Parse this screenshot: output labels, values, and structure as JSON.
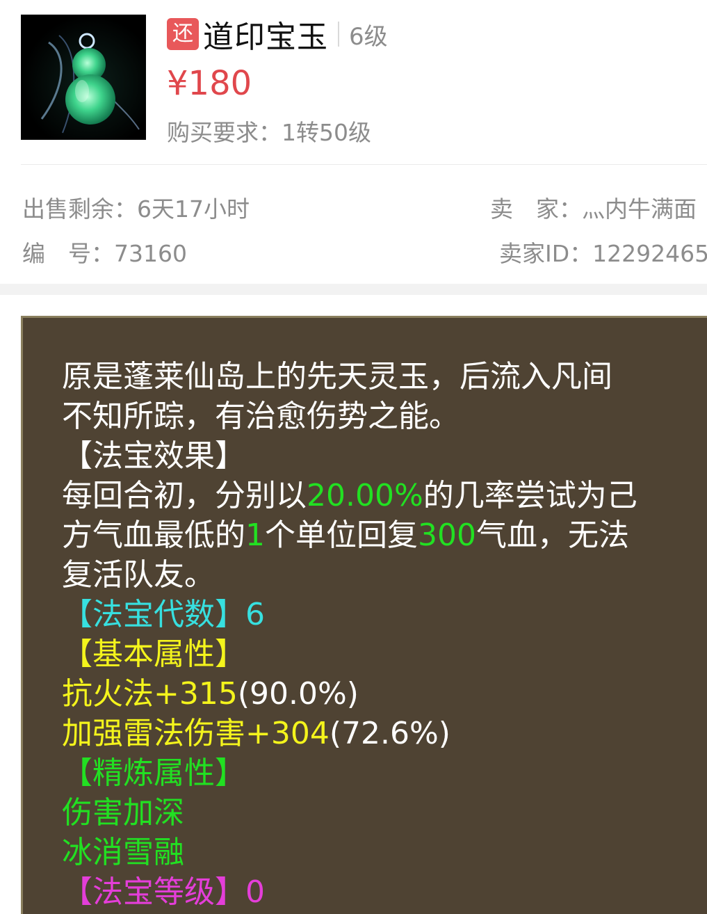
{
  "item": {
    "badge": "还",
    "name": "道印宝玉",
    "level": "6级",
    "price": "¥180",
    "requirement": "购买要求：1转50级"
  },
  "meta": {
    "remaining_label": "出售剩余：6天17小时",
    "seller_label": "卖　家：",
    "seller_name": "灬内牛满面",
    "id_label": "编　号：73160",
    "seller_id": "卖家ID：12292465"
  },
  "details": {
    "desc_line1": "原是蓬莱仙岛上的先天灵玉，后流入凡间",
    "desc_line2": "不知所踪，有治愈伤势之能。",
    "effect_header": "【法宝效果】",
    "effect_a1": "每回合初，分别以",
    "effect_a2": "20.00%",
    "effect_a3": "的几率尝试为己",
    "effect_b1": "方气血最低的",
    "effect_b2": "1",
    "effect_b3": "个单位回复",
    "effect_b4": "300",
    "effect_b5": "气血，无法",
    "effect_c": "复活队友。",
    "gen_label": "【法宝代数】6",
    "basic_header": "【基本属性】",
    "basic_1a": "抗火法+315",
    "basic_1b": "(90.0%)",
    "basic_2a": "加强雷法伤害+304",
    "basic_2b": "(72.6%)",
    "refine_header": "【精炼属性】",
    "refine_1": "伤害加深",
    "refine_2": "冰消雪融",
    "grade_label": "【法宝等级】0"
  },
  "colors": {
    "price": "#e0474c",
    "badge": "#e8585a",
    "panel_bg": "#4f4333",
    "green": "#22e022",
    "cyan": "#37e0e0",
    "yellow": "#f4f41c",
    "magenta": "#e43ed9"
  }
}
